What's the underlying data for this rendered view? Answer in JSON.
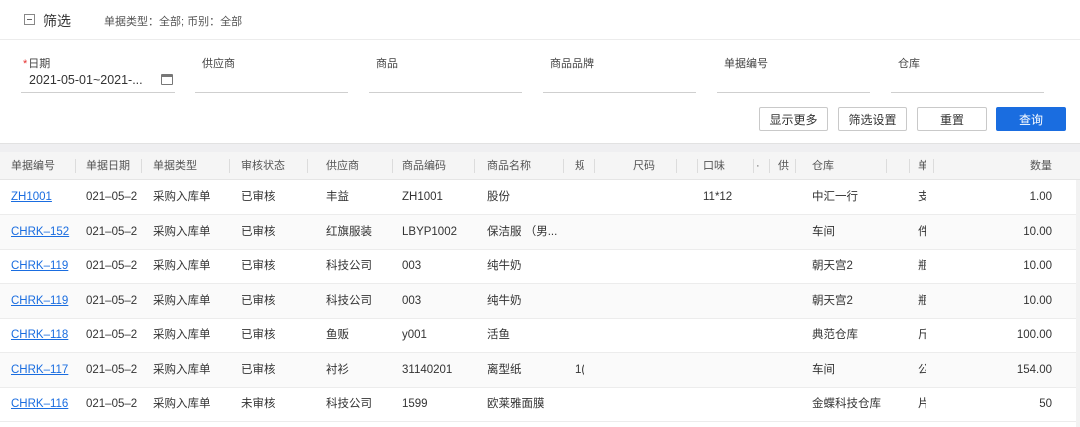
{
  "filter": {
    "title": "筛选",
    "summary": "单据类型：全部; 币别：全部",
    "fields": {
      "date_label": "日期",
      "date_required_mark": "*",
      "date_value": "2021-05-01~2021-...",
      "supplier_label": "供应商",
      "product_label": "商品",
      "brand_label": "商品品牌",
      "doc_no_label": "单据编号",
      "warehouse_label": "仓库"
    },
    "buttons": {
      "show_more": "显示更多",
      "filter_settings": "筛选设置",
      "reset": "重置",
      "query": "查询"
    }
  },
  "table": {
    "headers": [
      "单据编号",
      "单据日期",
      "单据类型",
      "审核状态",
      "供应商",
      "商品编码",
      "商品名称",
      "规",
      "尺码",
      "口味",
      "·",
      "供",
      "仓库",
      "单",
      "数量"
    ],
    "rows": [
      [
        "ZH1001",
        "021–05–2",
        "采购入库单",
        "已审核",
        "丰益",
        "ZH1001",
        "股份",
        "",
        "",
        "11*12",
        "",
        "",
        "中汇一行",
        "支",
        "1.00"
      ],
      [
        "CHRK–152",
        "021–05–2",
        "采购入库单",
        "已审核",
        "红旗服装",
        "LBYP1002",
        "保洁服 （男...",
        "",
        "",
        "",
        "",
        "",
        "车间",
        "件",
        "10.00"
      ],
      [
        "CHRK–119",
        "021–05–2",
        "采购入库单",
        "已审核",
        "科技公司",
        "003",
        "纯牛奶",
        "",
        "",
        "",
        "",
        "",
        "朝天宫2",
        "瓶",
        "10.00"
      ],
      [
        "CHRK–119",
        "021–05–2",
        "采购入库单",
        "已审核",
        "科技公司",
        "003",
        "纯牛奶",
        "",
        "",
        "",
        "",
        "",
        "朝天宫2",
        "瓶",
        "10.00"
      ],
      [
        "CHRK–118",
        "021–05–2",
        "采购入库单",
        "已审核",
        "鱼贩",
        "y001",
        "活鱼",
        "",
        "",
        "",
        "",
        "",
        "典范仓库",
        "斤",
        "100.00"
      ],
      [
        "CHRK–117",
        "021–05–2",
        "采购入库单",
        "已审核",
        "衬衫",
        "31140201",
        "离型纸",
        "1(",
        "",
        "",
        "",
        "",
        "车间",
        "公",
        "154.00"
      ],
      [
        "CHRK–116",
        "021–05–2",
        "采购入库单",
        "未审核",
        "科技公司",
        "1599",
        "欧莱雅面膜",
        "",
        "",
        "",
        "",
        "",
        "金蝶科技仓库",
        "片",
        "50"
      ]
    ]
  }
}
